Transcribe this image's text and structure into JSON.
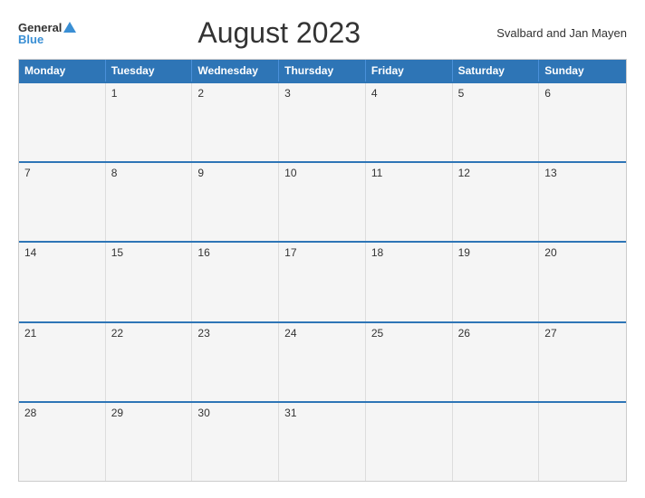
{
  "header": {
    "logo_general": "General",
    "logo_blue": "Blue",
    "title": "August 2023",
    "region": "Svalbard and Jan Mayen"
  },
  "days_of_week": [
    "Monday",
    "Tuesday",
    "Wednesday",
    "Thursday",
    "Friday",
    "Saturday",
    "Sunday"
  ],
  "weeks": [
    [
      {
        "day": "",
        "empty": true
      },
      {
        "day": "1"
      },
      {
        "day": "2"
      },
      {
        "day": "3"
      },
      {
        "day": "4"
      },
      {
        "day": "5"
      },
      {
        "day": "6"
      }
    ],
    [
      {
        "day": "7"
      },
      {
        "day": "8"
      },
      {
        "day": "9"
      },
      {
        "day": "10"
      },
      {
        "day": "11"
      },
      {
        "day": "12"
      },
      {
        "day": "13"
      }
    ],
    [
      {
        "day": "14"
      },
      {
        "day": "15"
      },
      {
        "day": "16"
      },
      {
        "day": "17"
      },
      {
        "day": "18"
      },
      {
        "day": "19"
      },
      {
        "day": "20"
      }
    ],
    [
      {
        "day": "21"
      },
      {
        "day": "22"
      },
      {
        "day": "23"
      },
      {
        "day": "24"
      },
      {
        "day": "25"
      },
      {
        "day": "26"
      },
      {
        "day": "27"
      }
    ],
    [
      {
        "day": "28"
      },
      {
        "day": "29"
      },
      {
        "day": "30"
      },
      {
        "day": "31"
      },
      {
        "day": "",
        "empty": true
      },
      {
        "day": "",
        "empty": true
      },
      {
        "day": "",
        "empty": true
      }
    ]
  ]
}
